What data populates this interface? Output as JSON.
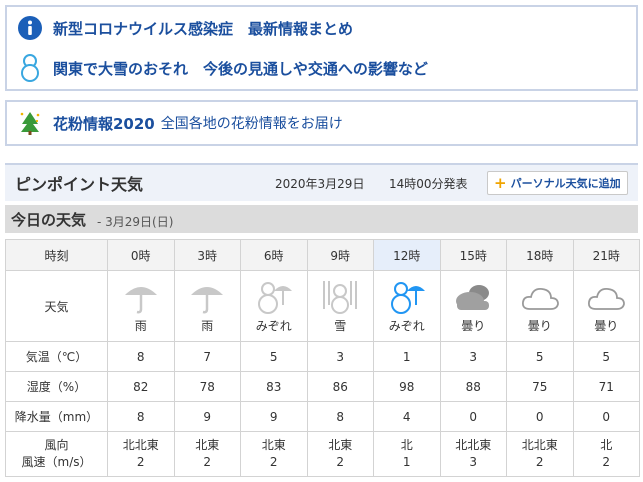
{
  "notices": [
    {
      "label": "新型コロナウイルス感染症　最新情報まとめ",
      "icon": "info-icon"
    },
    {
      "label": "関東で大雪のおそれ　今後の見通しや交通への影響など",
      "icon": "snowman-icon"
    }
  ],
  "pollen": {
    "title": "花粉情報2020",
    "desc": "全国各地の花粉情報をお届け",
    "icon": "tree-icon"
  },
  "pinpoint": {
    "title": "ピンポイント天気",
    "date": "2020年3月29日",
    "time": "14時00分発表",
    "add_button": "パーソナル天気に追加"
  },
  "today": {
    "title": "今日の天気",
    "date": "- 3月29日(日)"
  },
  "table": {
    "row_labels": {
      "time": "時刻",
      "weather": "天気",
      "temp": "気温（℃）",
      "humidity": "湿度（%）",
      "precip": "降水量（mm）",
      "wind_dir": "風向",
      "wind_speed": "風速（m/s）"
    },
    "columns": [
      {
        "time": "0時",
        "weather": "雨",
        "icon": "umbrella-icon",
        "temp": "8",
        "humidity": "82",
        "precip": "8",
        "wind_dir": "北北東",
        "wind_speed": "2"
      },
      {
        "time": "3時",
        "weather": "雨",
        "icon": "umbrella-icon",
        "temp": "7",
        "humidity": "78",
        "precip": "9",
        "wind_dir": "北東",
        "wind_speed": "2"
      },
      {
        "time": "6時",
        "weather": "みぞれ",
        "icon": "snowman-umbrella-icon",
        "temp": "5",
        "humidity": "83",
        "precip": "9",
        "wind_dir": "北東",
        "wind_speed": "2"
      },
      {
        "time": "9時",
        "weather": "雪",
        "icon": "snowman-snowfall-icon",
        "temp": "3",
        "humidity": "86",
        "precip": "8",
        "wind_dir": "北東",
        "wind_speed": "2"
      },
      {
        "time": "12時",
        "weather": "みぞれ",
        "icon": "snowman-umbrella-icon",
        "temp": "1",
        "humidity": "98",
        "precip": "4",
        "wind_dir": "北",
        "wind_speed": "1"
      },
      {
        "time": "15時",
        "weather": "曇り",
        "icon": "heavy-cloud-icon",
        "temp": "3",
        "humidity": "88",
        "precip": "0",
        "wind_dir": "北北東",
        "wind_speed": "3"
      },
      {
        "time": "18時",
        "weather": "曇り",
        "icon": "cloud-icon",
        "temp": "5",
        "humidity": "75",
        "precip": "0",
        "wind_dir": "北北東",
        "wind_speed": "2"
      },
      {
        "time": "21時",
        "weather": "曇り",
        "icon": "cloud-icon",
        "temp": "5",
        "humidity": "71",
        "precip": "0",
        "wind_dir": "北",
        "wind_speed": "2"
      }
    ]
  },
  "colors": {
    "link": "#1b4f9e",
    "accent": "#2196f3",
    "past": "#bdbdbd",
    "border": "#c9d3e6"
  }
}
